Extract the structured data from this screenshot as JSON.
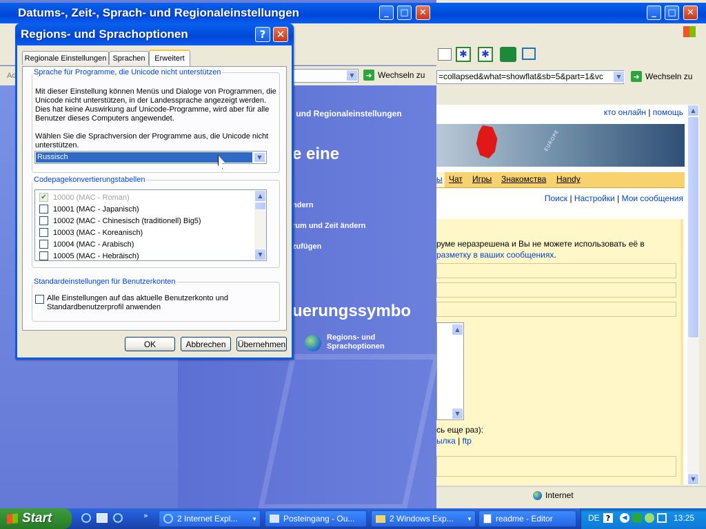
{
  "back_window": {
    "title": "Datums-, Zeit-, Sprach- und Regionaleinstellungen",
    "address_prefix": "Ad",
    "go_label": "Wechseln zu",
    "panel_heading": "ch- und Regionaleinstellungen",
    "big_text_1": "e eine",
    "links": [
      "ndern",
      "rum und Zeit ändern",
      "zufügen"
    ],
    "big_text_2": "uerungssymbo",
    "regions_label": "Regions- und Sprachoptionen"
  },
  "browser_window": {
    "address": "=collapsed&what=showflat&sb=5&part=1&vc",
    "go_label": "Wechseln zu",
    "top_links": [
      "кто онлайн",
      "помощь"
    ],
    "nav_tabs": [
      "ы",
      "Чат",
      "Игры",
      "Знакомства",
      "Handy"
    ],
    "sub_links": [
      "Поиск",
      "Настройки",
      "Мои сообщения"
    ],
    "notice_line1": "руме неразрешена и Вы не можете использовать её в",
    "notice_link": "разметку в ваших сообщениях",
    "notice_end": ".",
    "bottom_text": "сь еще раз):",
    "bottom_links": [
      "ылка",
      "ftp"
    ],
    "status_zone": "Internet",
    "map_label": "EUROPE"
  },
  "dialog": {
    "title": "Regions- und Sprachoptionen",
    "help_btn": "?",
    "tabs": [
      {
        "label": "Regionale Einstellungen",
        "active": false
      },
      {
        "label": "Sprachen",
        "active": false
      },
      {
        "label": "Erweitert",
        "active": true
      }
    ],
    "group1": {
      "legend": "Sprache für Programme, die Unicode nicht unterstützen",
      "desc_lines": [
        "Mit dieser Einstellung können Menüs und Dialoge von Programmen, die",
        "Unicode nicht unterstützen, in der Landessprache angezeigt werden.",
        "Dies hat keine Auswirkung auf Unicode-Programme, wird aber für alle",
        "Benutzer dieses Computers angewendet."
      ],
      "prompt_lines": [
        "Wählen Sie die Sprachversion der Programme aus, die Unicode nicht",
        "unterstützen."
      ],
      "selected": "Russisch"
    },
    "group2": {
      "legend": "Codepagekonvertierungstabellen",
      "items": [
        {
          "label": "10000 (MAC - Roman)",
          "checked": true,
          "disabled": true
        },
        {
          "label": "10001 (MAC - Japanisch)",
          "checked": false,
          "disabled": false
        },
        {
          "label": "10002 (MAC - Chinesisch (traditionell) Big5)",
          "checked": false,
          "disabled": false
        },
        {
          "label": "10003 (MAC - Koreanisch)",
          "checked": false,
          "disabled": false
        },
        {
          "label": "10004 (MAC - Arabisch)",
          "checked": false,
          "disabled": false
        },
        {
          "label": "10005 (MAC - Hebräisch)",
          "checked": false,
          "disabled": false
        }
      ]
    },
    "group3": {
      "legend": "Standardeinstellungen für Benutzerkonten",
      "checkbox_lines": [
        "Alle Einstellungen auf das aktuelle Benutzerkonto und",
        "Standardbenutzerprofil anwenden"
      ]
    },
    "buttons": {
      "ok": "OK",
      "cancel": "Abbrechen",
      "apply": "Übernehmen"
    }
  },
  "taskbar": {
    "start": "Start",
    "items": [
      "2 Internet Expl...",
      "Posteingang - Ou...",
      "2 Windows Exp...",
      "readme - Editor"
    ],
    "lang": "DE",
    "clock": "13:25"
  }
}
